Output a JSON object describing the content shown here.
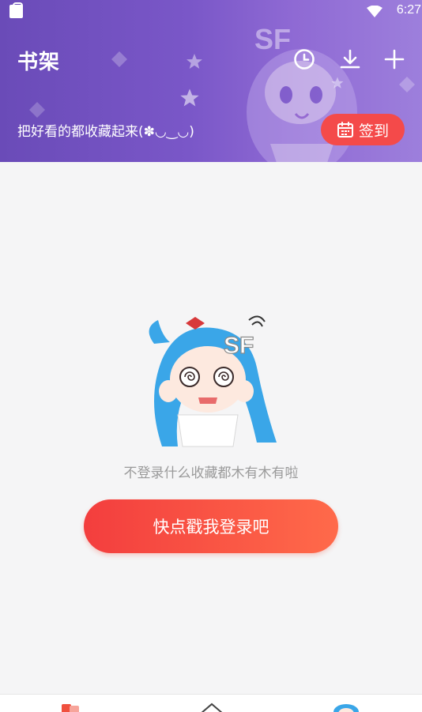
{
  "status_bar": {
    "time": "6:27"
  },
  "header": {
    "title": "书架",
    "subtitle": "把好看的都收藏起来(✽◡‿◡)",
    "signin_label": "签到",
    "icons": [
      "history-clock-icon",
      "download-icon",
      "add-icon"
    ]
  },
  "main": {
    "empty_message": "不登录什么收藏都木有木有啦",
    "login_button_label": "快点戳我登录吧"
  },
  "tabbar": {
    "icons": [
      "bookshelf-tab-icon",
      "home-tab-icon",
      "mascot-tab-icon"
    ]
  },
  "colors": {
    "header_purple": "#7a57c8",
    "accent_red": "#f44a4a",
    "background": "#f5f5f6"
  }
}
